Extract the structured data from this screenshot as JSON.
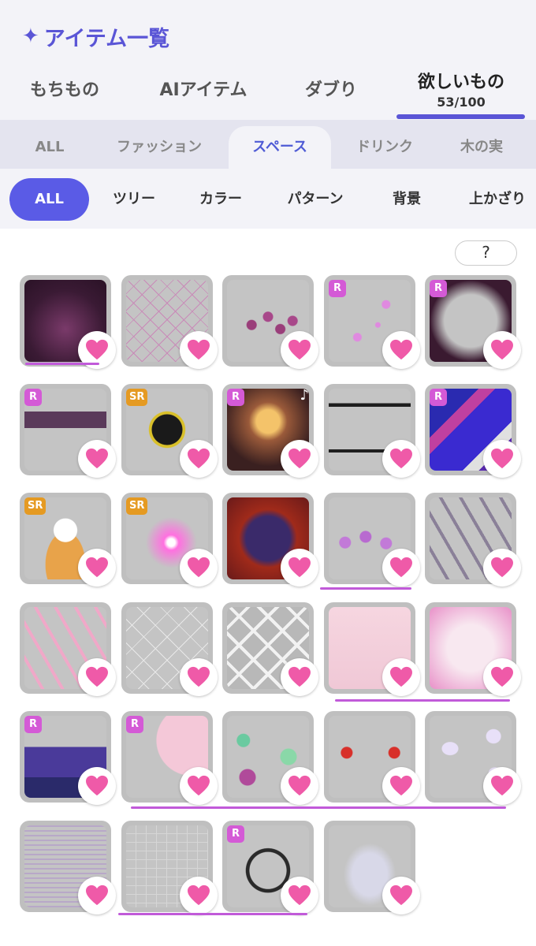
{
  "header": {
    "title": "アイテム一覧",
    "title_icon": "sparkle-icon",
    "tabs": [
      {
        "label": "もちもの",
        "active": false
      },
      {
        "label": "AIアイテム",
        "active": false
      },
      {
        "label": "ダブり",
        "active": false
      },
      {
        "label": "欲しいもの",
        "active": true,
        "count": "53/100"
      }
    ]
  },
  "category_tabs": [
    "ALL",
    "ファッション",
    "スペース",
    "ドリンク",
    "木の実"
  ],
  "category_active": "スペース",
  "filter_chips": [
    "ALL",
    "ツリー",
    "カラー",
    "パターン",
    "背景",
    "上かざり"
  ],
  "filter_active": "ALL",
  "help_label": "?",
  "colors": {
    "accent": "#5a55d6",
    "heart": "#ef5aa8",
    "badge_r": "#d45ad6",
    "badge_sr": "#e59a22",
    "annotation": "#c15ad9"
  },
  "items": [
    {
      "rarity": "",
      "art": "pink-dark-gradient-background"
    },
    {
      "rarity": "",
      "art": "diamond-lattice-pattern"
    },
    {
      "rarity": "",
      "art": "pink-box-cluster"
    },
    {
      "rarity": "R",
      "art": "butterfly-sparkles"
    },
    {
      "rarity": "R",
      "art": "dark-butterfly-frame"
    },
    {
      "rarity": "R",
      "art": "purple-table-with-books"
    },
    {
      "rarity": "SR",
      "art": "black-gold-emblem"
    },
    {
      "rarity": "R",
      "art": "chandelier-room",
      "music": true
    },
    {
      "rarity": "",
      "art": "green-black-stripes"
    },
    {
      "rarity": "R",
      "art": "neon-city-panels"
    },
    {
      "rarity": "SR",
      "art": "character-in-basket"
    },
    {
      "rarity": "SR",
      "art": "glowing-pink-butterfly"
    },
    {
      "rarity": "",
      "art": "red-purple-oval-frame"
    },
    {
      "rarity": "",
      "art": "purple-gift-boxes"
    },
    {
      "rarity": "",
      "art": "gray-cross-ribbon"
    },
    {
      "rarity": "",
      "art": "pink-cross-ribbon"
    },
    {
      "rarity": "",
      "art": "white-heart-lattice"
    },
    {
      "rarity": "",
      "art": "white-crosshatch"
    },
    {
      "rarity": "",
      "art": "soft-pink-background"
    },
    {
      "rarity": "",
      "art": "pink-gradient-background"
    },
    {
      "rarity": "R",
      "art": "night-city-skyline"
    },
    {
      "rarity": "R",
      "art": "cherry-blossom-corner"
    },
    {
      "rarity": "",
      "art": "floating-green-plants"
    },
    {
      "rarity": "",
      "art": "red-lanterns"
    },
    {
      "rarity": "",
      "art": "pastel-clouds"
    },
    {
      "rarity": "",
      "art": "purple-horizontal-lines"
    },
    {
      "rarity": "",
      "art": "perspective-grid-floor"
    },
    {
      "rarity": "R",
      "art": "black-square-frames"
    },
    {
      "rarity": "",
      "art": "translucent-sphere"
    }
  ]
}
